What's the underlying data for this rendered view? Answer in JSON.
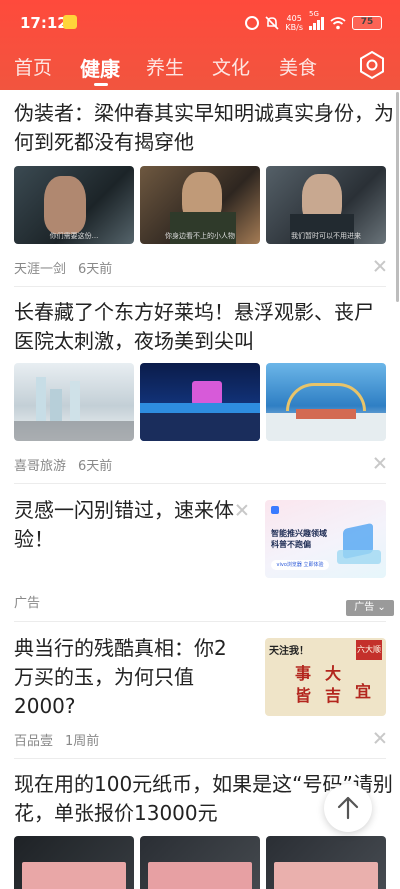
{
  "status_bar": {
    "time": "17:12",
    "net_speed_value": "405",
    "net_speed_unit": "KB/s",
    "network": "5G",
    "battery": "75"
  },
  "tabs": [
    {
      "label": "首页"
    },
    {
      "label": "健康"
    },
    {
      "label": "养生"
    },
    {
      "label": "文化"
    },
    {
      "label": "美食"
    }
  ],
  "articles": [
    {
      "title": "伪装者：梁仲春其实早知明诚真实身份，为何到死都没有揭穿他",
      "source": "天涯一剑",
      "time": "6天前",
      "thumb_captions": [
        "你们需要这份...",
        "你身边看不上的小人物",
        "我们暂时可以不用进来"
      ]
    },
    {
      "title": "长春藏了个东方好莱坞！悬浮观影、丧尸医院太刺激，夜场美到尖叫",
      "source": "喜哥旅游",
      "time": "6天前"
    },
    {
      "title": "灵感一闪别错过，速来体验！",
      "ad_label": "广告",
      "ad_badge": "广告",
      "ad_image_line1": "智能推兴趣领域",
      "ad_image_line2": "科普不跑偏",
      "ad_image_button": "vivo浏览器 立即体验"
    },
    {
      "title": "典当行的残酷真相：你2万买的玉，为何只值2000?",
      "source": "百品壹",
      "time": "1周前",
      "thumb_words": [
        "天注我！",
        "六大顺",
        "事",
        "大",
        "皆",
        "吉",
        "宜"
      ]
    },
    {
      "title": "现在用的100元纸币，如果是这“号码”请别花，单张报价13000元"
    }
  ],
  "colors": {
    "header_red": "#f1553f",
    "text": "#222222",
    "meta": "#888888"
  }
}
